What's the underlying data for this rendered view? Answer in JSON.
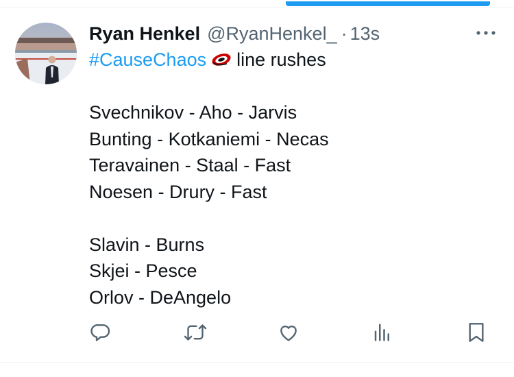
{
  "tweet": {
    "author": {
      "display_name": "Ryan Henkel",
      "handle": "@RyanHenkel_",
      "separator": "·",
      "time": "13s"
    },
    "hashtag": "#CauseChaos",
    "emoji": "hurricanes-logo-icon",
    "headline_rest": "line rushes",
    "forward_lines": [
      "Svechnikov - Aho - Jarvis",
      "Bunting - Kotkaniemi - Necas",
      "Teravainen - Staal - Fast",
      "Noesen - Drury - Fast"
    ],
    "defense_pairs": [
      "Slavin - Burns",
      "Skjei - Pesce",
      "Orlov - DeAngelo"
    ]
  },
  "actions": [
    "reply-icon",
    "retweet-icon",
    "like-icon",
    "views-icon",
    "bookmark-icon"
  ],
  "colors": {
    "accent": "#1d9bf0",
    "text": "#0f1419",
    "secondary": "#536471",
    "divider": "#eff3f4"
  }
}
